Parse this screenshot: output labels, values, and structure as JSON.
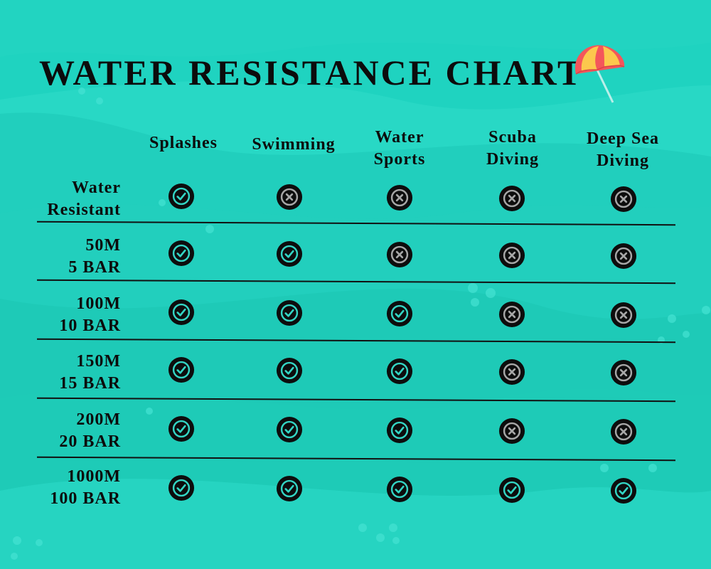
{
  "title": "WATER RESISTANCE CHART",
  "icons": {
    "yes": "check-circle-icon",
    "no": "x-circle-icon",
    "decoration": "beach-umbrella-icon"
  },
  "colors": {
    "background": "#1fd3c0",
    "check_ring": "#33d5c4",
    "x_ring": "#a7a7a7",
    "text": "#0c0c0c"
  },
  "columns": [
    {
      "line1": "Splashes",
      "line2": ""
    },
    {
      "line1": "Swimming",
      "line2": ""
    },
    {
      "line1": "Water",
      "line2": "Sports"
    },
    {
      "line1": "Scuba",
      "line2": "Diving"
    },
    {
      "line1": "Deep Sea",
      "line2": "Diving"
    }
  ],
  "rows": [
    {
      "line1": "Water",
      "line2": "Resistant",
      "cells": [
        "yes",
        "no",
        "no",
        "no",
        "no"
      ]
    },
    {
      "line1": "50M",
      "line2": "5 BAR",
      "cells": [
        "yes",
        "yes",
        "no",
        "no",
        "no"
      ]
    },
    {
      "line1": "100M",
      "line2": "10 BAR",
      "cells": [
        "yes",
        "yes",
        "yes",
        "no",
        "no"
      ]
    },
    {
      "line1": "150M",
      "line2": "15 BAR",
      "cells": [
        "yes",
        "yes",
        "yes",
        "no",
        "no"
      ]
    },
    {
      "line1": "200M",
      "line2": "20 BAR",
      "cells": [
        "yes",
        "yes",
        "yes",
        "no",
        "no"
      ]
    },
    {
      "line1": "1000M",
      "line2": "100 BAR",
      "cells": [
        "yes",
        "yes",
        "yes",
        "yes",
        "yes"
      ]
    }
  ]
}
